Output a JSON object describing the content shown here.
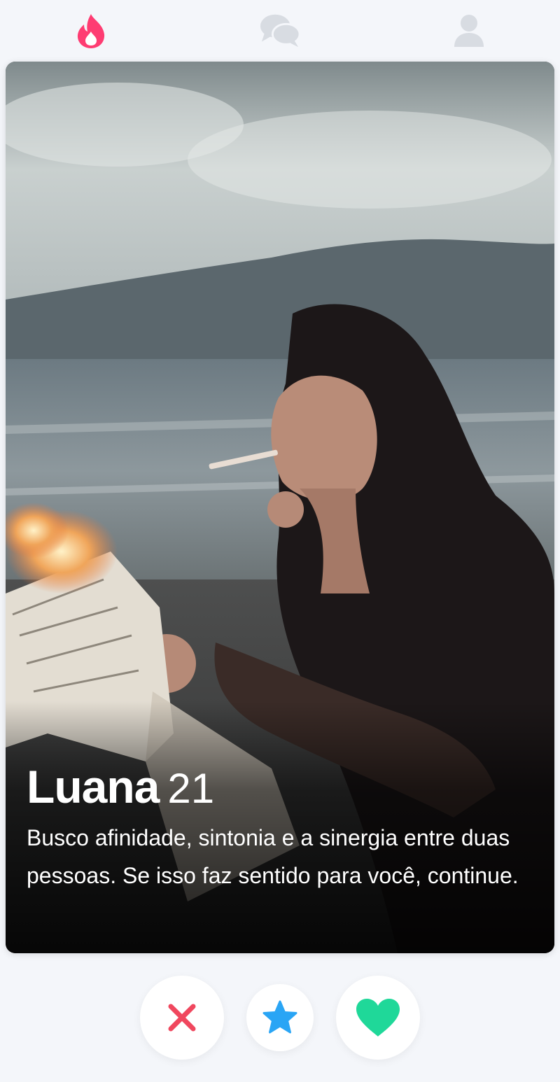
{
  "nav": {
    "items": [
      {
        "icon": "flame-icon",
        "active": true,
        "color": "#fe3c72"
      },
      {
        "icon": "chat-icon",
        "active": false,
        "color": "#d8dce2"
      },
      {
        "icon": "profile-icon",
        "active": false,
        "color": "#d8dce2"
      }
    ]
  },
  "profile": {
    "name": "Luana",
    "age": "21",
    "bio": "Busco afinidade, sintonia e a sinergia entre duas pessoas. Se isso faz sentido para você, continue."
  },
  "actions": {
    "nope": {
      "icon": "close-icon",
      "color": "#f0475e"
    },
    "super_like": {
      "icon": "star-icon",
      "color": "#2aa5f5"
    },
    "like": {
      "icon": "heart-icon",
      "color": "#1fd899"
    }
  }
}
